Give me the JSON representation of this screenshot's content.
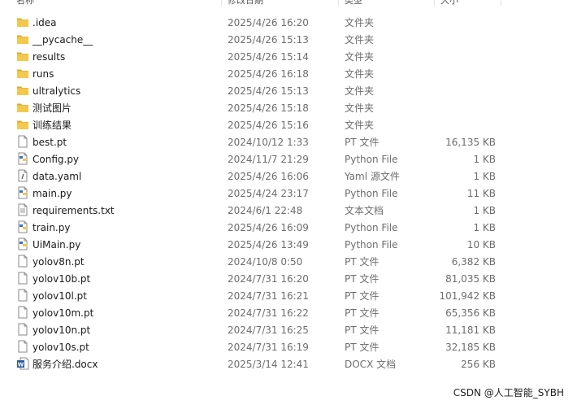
{
  "header": {
    "name": "名称",
    "date": "修改日期",
    "type": "类型",
    "size": "大小"
  },
  "files": [
    {
      "name": ".idea",
      "date": "2025/4/26 16:20",
      "type": "文件夹",
      "size": "",
      "icon": "folder-icon"
    },
    {
      "name": "__pycache__",
      "date": "2025/4/26 15:13",
      "type": "文件夹",
      "size": "",
      "icon": "folder-icon"
    },
    {
      "name": "results",
      "date": "2025/4/26 15:14",
      "type": "文件夹",
      "size": "",
      "icon": "folder-icon"
    },
    {
      "name": "runs",
      "date": "2025/4/26 16:18",
      "type": "文件夹",
      "size": "",
      "icon": "folder-icon"
    },
    {
      "name": "ultralytics",
      "date": "2025/4/26 15:13",
      "type": "文件夹",
      "size": "",
      "icon": "folder-icon"
    },
    {
      "name": "测试图片",
      "date": "2025/4/26 15:18",
      "type": "文件夹",
      "size": "",
      "icon": "folder-icon"
    },
    {
      "name": "训练结果",
      "date": "2025/4/26 15:16",
      "type": "文件夹",
      "size": "",
      "icon": "folder-icon"
    },
    {
      "name": "best.pt",
      "date": "2024/10/12 1:33",
      "type": "PT 文件",
      "size": "16,135 KB",
      "icon": "file-icon"
    },
    {
      "name": "Config.py",
      "date": "2024/11/7 21:29",
      "type": "Python File",
      "size": "1 KB",
      "icon": "python-file-icon"
    },
    {
      "name": "data.yaml",
      "date": "2025/4/26 16:06",
      "type": "Yaml 源文件",
      "size": "1 KB",
      "icon": "yaml-file-icon"
    },
    {
      "name": "main.py",
      "date": "2025/4/24 23:17",
      "type": "Python File",
      "size": "11 KB",
      "icon": "python-file-icon"
    },
    {
      "name": "requirements.txt",
      "date": "2024/6/1 22:48",
      "type": "文本文档",
      "size": "1 KB",
      "icon": "text-file-icon"
    },
    {
      "name": "train.py",
      "date": "2025/4/26 16:09",
      "type": "Python File",
      "size": "1 KB",
      "icon": "python-file-icon"
    },
    {
      "name": "UiMain.py",
      "date": "2025/4/26 13:49",
      "type": "Python File",
      "size": "10 KB",
      "icon": "python-file-icon"
    },
    {
      "name": "yolov8n.pt",
      "date": "2024/10/8 0:50",
      "type": "PT 文件",
      "size": "6,382 KB",
      "icon": "file-icon"
    },
    {
      "name": "yolov10b.pt",
      "date": "2024/7/31 16:20",
      "type": "PT 文件",
      "size": "81,035 KB",
      "icon": "file-icon"
    },
    {
      "name": "yolov10l.pt",
      "date": "2024/7/31 16:21",
      "type": "PT 文件",
      "size": "101,942 KB",
      "icon": "file-icon"
    },
    {
      "name": "yolov10m.pt",
      "date": "2024/7/31 16:22",
      "type": "PT 文件",
      "size": "65,356 KB",
      "icon": "file-icon"
    },
    {
      "name": "yolov10n.pt",
      "date": "2024/7/31 16:25",
      "type": "PT 文件",
      "size": "11,181 KB",
      "icon": "file-icon"
    },
    {
      "name": "yolov10s.pt",
      "date": "2024/7/31 16:19",
      "type": "PT 文件",
      "size": "32,185 KB",
      "icon": "file-icon"
    },
    {
      "name": "服务介绍.docx",
      "date": "2025/3/14 12:41",
      "type": "DOCX 文档",
      "size": "256 KB",
      "icon": "word-file-icon"
    }
  ],
  "watermark": "CSDN @人工智能_SYBH",
  "colors": {
    "folder": "#f2c94c",
    "folder_dark": "#e0a82e",
    "python_blue": "#3b73b9",
    "python_yellow": "#f3c63f",
    "word_blue": "#2b579a"
  }
}
